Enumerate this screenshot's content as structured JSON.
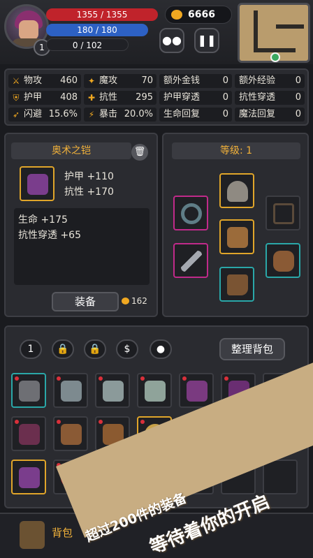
{
  "hud": {
    "hp": "1355 / 1355",
    "mp": "180 / 180",
    "xp": "0 / 102",
    "level": "1",
    "gold": "6666",
    "buttons": [
      {
        "icon": "pet-icon"
      },
      {
        "icon": "pause-icon"
      }
    ]
  },
  "stats": [
    {
      "label": "物攻",
      "value": "460",
      "icon": "sword-icon"
    },
    {
      "label": "魔攻",
      "value": "70",
      "icon": "magic-icon"
    },
    {
      "label": "额外金钱",
      "value": "0"
    },
    {
      "label": "额外经验",
      "value": "0"
    },
    {
      "label": "护甲",
      "value": "408",
      "icon": "armor-icon"
    },
    {
      "label": "抗性",
      "value": "295",
      "icon": "resist-icon"
    },
    {
      "label": "护甲穿透",
      "value": "0"
    },
    {
      "label": "抗性穿透",
      "value": "0"
    },
    {
      "label": "闪避",
      "value": "15.6%",
      "icon": "dodge-icon"
    },
    {
      "label": "暴击",
      "value": "20.0%",
      "icon": "crit-icon"
    },
    {
      "label": "生命回复",
      "value": "0"
    },
    {
      "label": "魔法回复",
      "value": "0"
    }
  ],
  "item": {
    "name": "奥术之铠",
    "main1": "护甲 +110",
    "main2": "抗性 +170",
    "extra1": "生命 +175",
    "extra2": "抗性穿透 +65",
    "equip_label": "装备",
    "price": "162"
  },
  "equip_panel": {
    "title": "等级: 1"
  },
  "inventory": {
    "page": "1",
    "sort_label": "整理背包",
    "money_icon": "$"
  },
  "bottom": {
    "bag_label": "背包"
  },
  "promo": {
    "line1": "超过200件的装备",
    "line2": "等待着你的开启"
  }
}
